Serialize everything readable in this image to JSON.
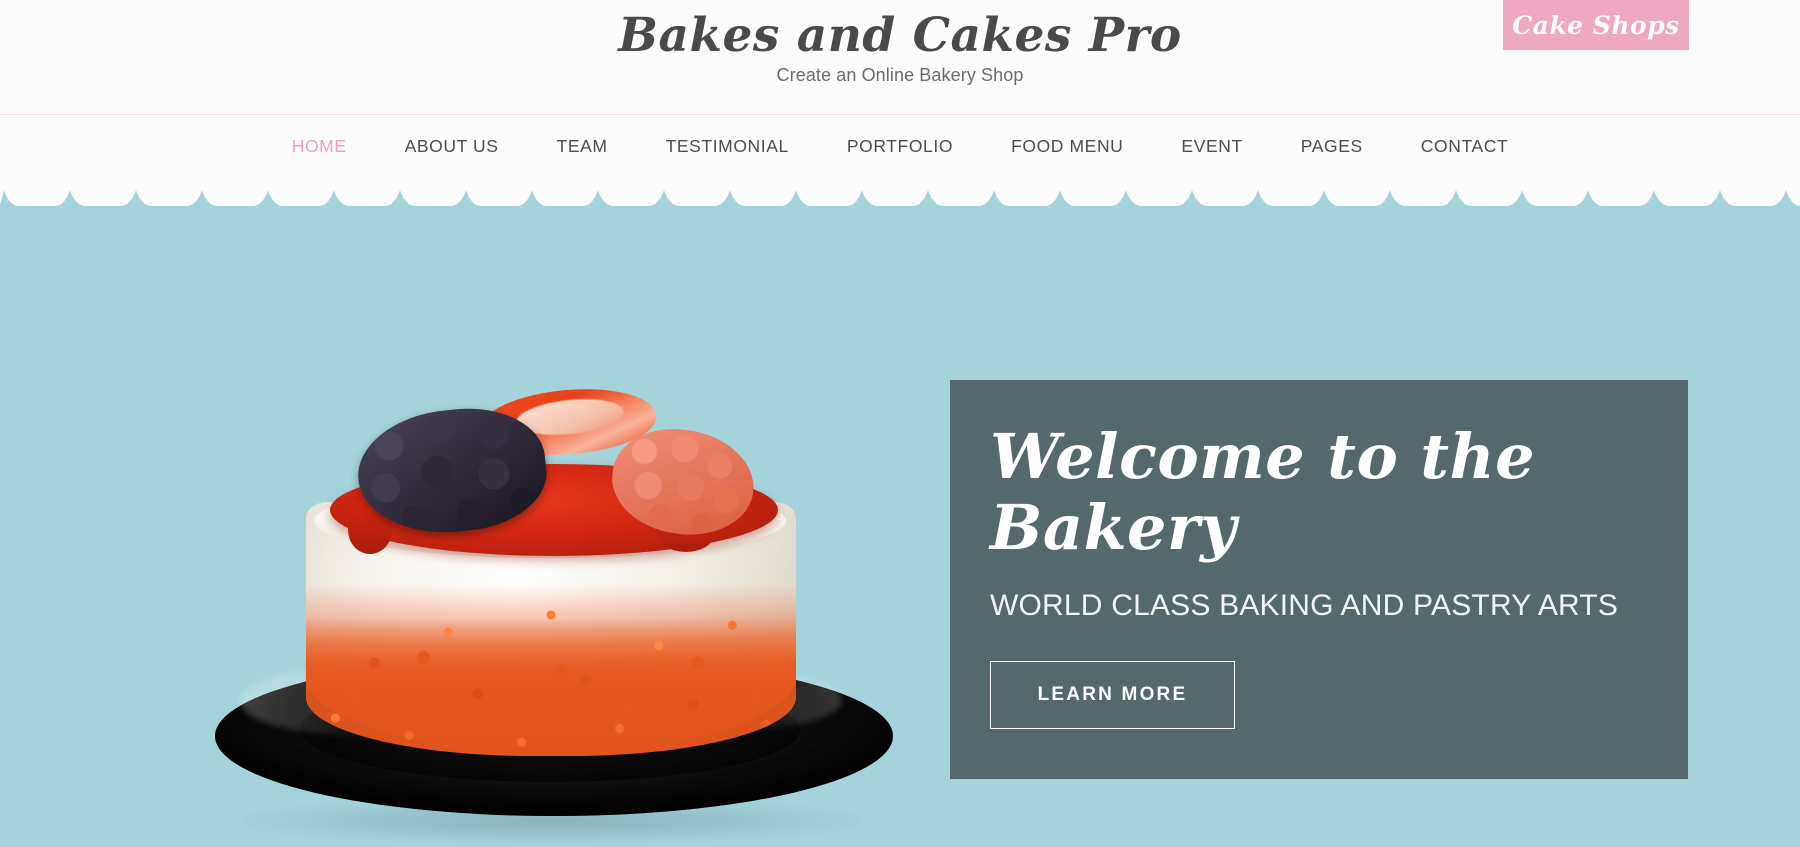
{
  "header": {
    "site_title": "Bakes and Cakes Pro",
    "tagline": "Create an Online Bakery Shop",
    "shop_button_label": "Cake Shops",
    "accent_pink": "#eea8c2",
    "divider_color": "#f5dde5"
  },
  "nav": {
    "items": [
      {
        "label": "HOME",
        "active": true
      },
      {
        "label": "ABOUT US",
        "active": false
      },
      {
        "label": "TEAM",
        "active": false
      },
      {
        "label": "TESTIMONIAL",
        "active": false
      },
      {
        "label": "PORTFOLIO",
        "active": false
      },
      {
        "label": "FOOD MENU",
        "active": false
      },
      {
        "label": "EVENT",
        "active": false
      },
      {
        "label": "PAGES",
        "active": false
      },
      {
        "label": "CONTACT",
        "active": false
      }
    ],
    "active_color": "#ef9ebc",
    "inactive_color": "#4d4d4d"
  },
  "hero": {
    "background_color": "#a4d3da",
    "image_alt": "strawberry-cake-on-black-plate",
    "overlay": {
      "background_color": "#55686b",
      "title_line1": "Welcome to the",
      "title_line2": "Bakery",
      "subtitle": "WORLD CLASS BAKING AND PASTRY ARTS",
      "cta_label": "LEARN MORE"
    }
  }
}
